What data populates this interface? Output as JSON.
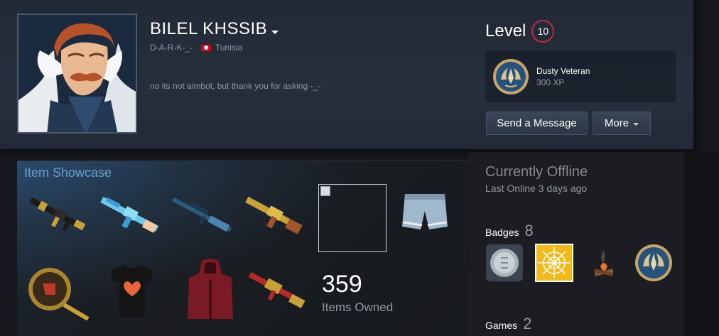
{
  "profile": {
    "name": "BILEL KHSSIB",
    "alias": "D-A-R-K-_-",
    "country": "Tunisia",
    "summary": "no its not aimbot, but thank you for asking -_-"
  },
  "level": {
    "label": "Level",
    "value": "10"
  },
  "favorite_badge": {
    "name": "Dusty Veteran",
    "xp": "300 XP"
  },
  "actions": {
    "send_message": "Send a Message",
    "more": "More"
  },
  "showcase": {
    "title": "Item Showcase",
    "count": "359",
    "count_label": "Items Owned",
    "items": [
      {
        "icon": "assault-rifle-black-gold"
      },
      {
        "icon": "rifle-blue-camo"
      },
      {
        "icon": "sniper-rifle-blue"
      },
      {
        "icon": "rifle-gold"
      },
      {
        "icon": "broken-image"
      },
      {
        "icon": "denim-shorts"
      },
      {
        "icon": "gold-pan-emblem"
      },
      {
        "icon": "black-tshirt-heart"
      },
      {
        "icon": "red-hooded-jacket"
      },
      {
        "icon": "rifle-red-gold"
      }
    ]
  },
  "status": {
    "state": "Currently Offline",
    "last_online": "Last Online 3 days ago"
  },
  "badges": {
    "label": "Badges",
    "count": "8",
    "icons": [
      "silver-coin-badge",
      "gold-web-badge",
      "campfire-badge",
      "veteran-badge"
    ]
  },
  "games": {
    "label": "Games",
    "count": "2"
  },
  "colors": {
    "accent_blue": "#6b9fd4",
    "level_ring": "#c02942",
    "header_bg": "#262f3d"
  }
}
